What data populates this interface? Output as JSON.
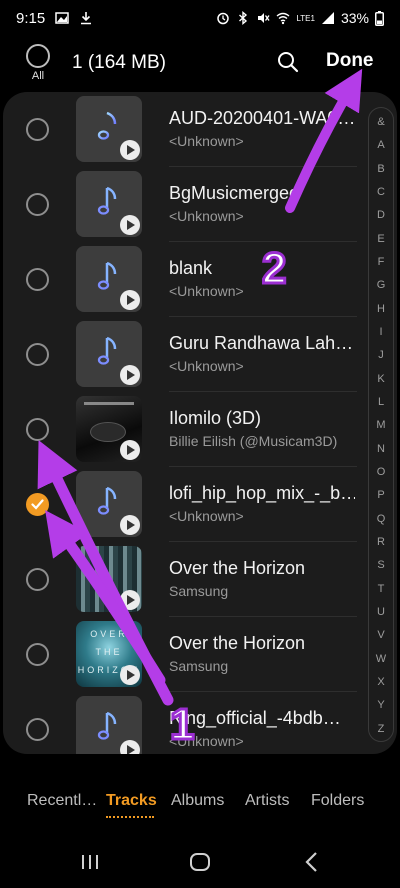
{
  "status": {
    "time": "9:15",
    "battery": "33%",
    "network": "LTE1"
  },
  "header": {
    "all_label": "All",
    "selection": "1 (164 MB)",
    "done": "Done"
  },
  "tracks": [
    {
      "title": "AUD-20200401-WA0…",
      "subtitle": "<Unknown>",
      "checked": false,
      "art": "music-note-icon"
    },
    {
      "title": "BgMusicmerged",
      "subtitle": "<Unknown>",
      "checked": false,
      "art": "music-note-icon"
    },
    {
      "title": "blank",
      "subtitle": "<Unknown>",
      "checked": false,
      "art": "music-note-icon"
    },
    {
      "title": "Guru Randhawa Lah…",
      "subtitle": "<Unknown>",
      "checked": false,
      "art": "music-note-icon"
    },
    {
      "title": "Ilomilo (3D)",
      "subtitle": "Billie Eilish (@Musicam3D)",
      "checked": false,
      "art": "album-art"
    },
    {
      "title": "lofi_hip_hop_mix_-_b…",
      "subtitle": "<Unknown>",
      "checked": true,
      "art": "music-note-icon"
    },
    {
      "title": "Over the Horizon",
      "subtitle": "Samsung",
      "checked": false,
      "art": "album-art"
    },
    {
      "title": "Over the Horizon",
      "subtitle": "Samsung",
      "checked": false,
      "art": "album-art"
    },
    {
      "title": "Ring_official_-4bdb…",
      "subtitle": "<Unknown>",
      "checked": false,
      "art": "music-note-icon"
    }
  ],
  "art_text": {
    "horizon_top": "OVER",
    "horizon_mid": "THE",
    "horizon_bottom": "HORIZON"
  },
  "index_letters": [
    "&",
    "A",
    "B",
    "C",
    "D",
    "E",
    "F",
    "G",
    "H",
    "I",
    "J",
    "K",
    "L",
    "M",
    "N",
    "O",
    "P",
    "Q",
    "R",
    "S",
    "T",
    "U",
    "V",
    "W",
    "X",
    "Y",
    "Z"
  ],
  "tabs": [
    "Recentl…",
    "Tracks",
    "Albums",
    "Artists",
    "Folders"
  ],
  "active_tab": "Tracks",
  "annotations": {
    "one": "1",
    "two": "2"
  },
  "colors": {
    "accent": "#f29b23",
    "annotation": "#9b2ed1",
    "panel": "#1c1c1c"
  }
}
